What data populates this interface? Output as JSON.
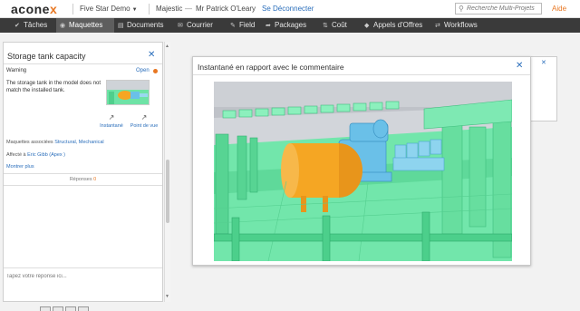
{
  "header": {
    "logo_main": "acone",
    "logo_x": "x",
    "project": "Five Star Demo",
    "organization": "Majestic",
    "separator": "—",
    "user": "Mr Patrick O'Leary",
    "logout": "Se Déconnecter",
    "search_placeholder": "Recherche Multi-Projets",
    "help": "Aide"
  },
  "nav": {
    "tabs": [
      {
        "label": "Tâches",
        "icon": "check-icon"
      },
      {
        "label": "Maquettes",
        "icon": "cube-icon",
        "active": true
      },
      {
        "label": "Documents",
        "icon": "documents-icon"
      },
      {
        "label": "Courrier",
        "icon": "mail-icon"
      },
      {
        "label": "Field",
        "icon": "field-icon"
      },
      {
        "label": "Packages",
        "icon": "package-icon"
      },
      {
        "label": "Coût",
        "icon": "cost-icon"
      },
      {
        "label": "Appels d'Offres",
        "icon": "tender-icon"
      },
      {
        "label": "Workflows",
        "icon": "workflow-icon"
      }
    ]
  },
  "issue": {
    "title": "Storage tank capacity",
    "type": "Warning",
    "status": "Open",
    "status_color": "#e87722",
    "description": "The storage tank in the model does not match the installed tank.",
    "snapshot_label": "Instantané",
    "viewpoint_label": "Point de vue",
    "models_label": "Maquettes associées",
    "models_value": "Structural, Mechanical",
    "assigned_label": "Affecté à",
    "assigned_value": "Eric Gibb (Apex )",
    "more_label": "Montrer plus",
    "replies_label": "Réponses",
    "replies_count": "0",
    "reply_placeholder": "Tapez votre réponse ici..."
  },
  "modal": {
    "title": "Instantané en rapport avec le commentaire"
  },
  "colors": {
    "accent": "#e87722",
    "link": "#2a6ebb",
    "nav_bg": "#3a3a3a",
    "structure_green": "#5ee4a0",
    "tank_orange": "#f5a623",
    "pump_blue": "#6ac0e8"
  }
}
